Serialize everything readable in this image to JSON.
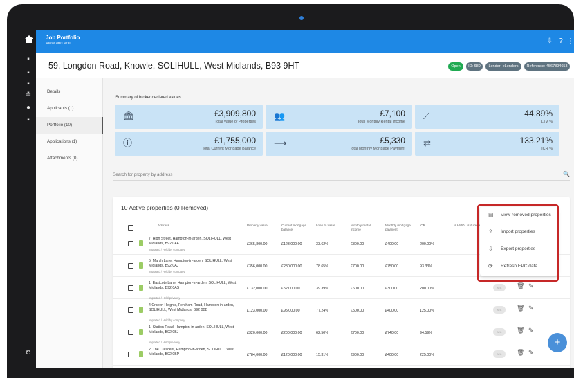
{
  "app": {
    "title": "Job Portfolio",
    "subtitle": "View and edit"
  },
  "header": {
    "address": "59, Longdon Road, Knowle, SOLIHULL, West Midlands, B93 9HT",
    "badges": [
      {
        "label": "Open",
        "color": "#1faa52"
      },
      {
        "label": "ID: 689",
        "color": "#5f7380"
      },
      {
        "label": "Lender: eLenders",
        "color": "#5f7380"
      },
      {
        "label": "Reference: 4567894653",
        "color": "#5f7380"
      }
    ]
  },
  "nav": {
    "items": [
      {
        "label": "Details"
      },
      {
        "label": "Applicants (1)"
      },
      {
        "label": "Portfolio (10)"
      },
      {
        "label": "Applications (1)"
      },
      {
        "label": "Attachments (0)"
      }
    ]
  },
  "summary": {
    "title": "Summary of broker declared values",
    "cards": [
      {
        "icon": "bank-icon",
        "value": "£3,909,800",
        "label": "Total Value of Properties"
      },
      {
        "icon": "people-icon",
        "value": "£7,100",
        "label": "Total Monthly Rental Income"
      },
      {
        "icon": "trend-icon",
        "value": "44.89%",
        "label": "LTV %"
      },
      {
        "icon": "info-icon",
        "value": "£1,755,000",
        "label": "Total Current Mortgage Balance"
      },
      {
        "icon": "arrow-right-icon",
        "value": "£5,330",
        "label": "Total Monthly Mortgage Payment"
      },
      {
        "icon": "swap-icon",
        "value": "133.21%",
        "label": "ICR %"
      }
    ]
  },
  "search": {
    "placeholder": "Search for property by address"
  },
  "properties": {
    "title": "10 Active properties (0 Removed)",
    "columns": [
      "Address",
      "Property value",
      "Current mortgage balance",
      "Loan to value",
      "Monthly rental income",
      "Monthly mortgage payment",
      "ICR",
      "Is HMO",
      "Is duplicate"
    ],
    "rows": [
      {
        "address": "7, High Street, Hampton-in-arden, SOLIHULL, West Midlands, B92 0AE",
        "tag": "Imported / Held by company",
        "value": "£365,800.00",
        "balance": "£123,000.00",
        "ltv": "33.62%",
        "rent": "£800.00",
        "payment": "£400.00",
        "icr": "200.00%"
      },
      {
        "address": "5, Marsh Lane, Hampton-in-arden, SOLIHULL, West Midlands, B92 0AJ",
        "tag": "Imported / Held by company",
        "value": "£356,000.00",
        "balance": "£280,000.00",
        "ltv": "78.65%",
        "rent": "£700.00",
        "payment": "£750.00",
        "icr": "93.33%"
      },
      {
        "address": "1, Eastcote Lane, Hampton-in-arden, SOLIHULL, West Midlands, B92 0AS",
        "tag": "Imported / Held privately",
        "value": "£132,000.00",
        "balance": "£52,000.00",
        "ltv": "39.39%",
        "rent": "£600.00",
        "payment": "£300.00",
        "icr": "200.00%"
      },
      {
        "address": "4 Craven Heights, Fentham Road, Hampton-in-arden, SOLIHULL, West Midlands, B92 0BB",
        "tag": "Imported / Held by company",
        "value": "£123,000.00",
        "balance": "£95,000.00",
        "ltv": "77.24%",
        "rent": "£500.00",
        "payment": "£400.00",
        "icr": "125.00%"
      },
      {
        "address": "1, Station Road, Hampton-in-arden, SOLIHULL, West Midlands, B92 0BJ",
        "tag": "Imported / Held privately",
        "value": "£320,000.00",
        "balance": "£200,000.00",
        "ltv": "62.50%",
        "rent": "£700.00",
        "payment": "£740.00",
        "icr": "94.59%"
      },
      {
        "address": "2, The Crescent, Hampton-in-arden, SOLIHULL, West Midlands, B92 0BP",
        "tag": "",
        "value": "£784,000.00",
        "balance": "£120,000.00",
        "ltv": "15.31%",
        "rent": "£900.00",
        "payment": "£400.00",
        "icr": "225.00%"
      }
    ],
    "pill": "N/A"
  },
  "menu": {
    "items": [
      {
        "icon": "removed-list-icon",
        "label": "View removed properties"
      },
      {
        "icon": "upload-icon",
        "label": "Import properties"
      },
      {
        "icon": "download-icon",
        "label": "Export properties"
      },
      {
        "icon": "refresh-icon",
        "label": "Refresh EPC data"
      }
    ]
  },
  "colors": {
    "primary": "#1e88e5",
    "card": "#c9e3f6",
    "open": "#1faa52",
    "highlight": "#c62828"
  }
}
